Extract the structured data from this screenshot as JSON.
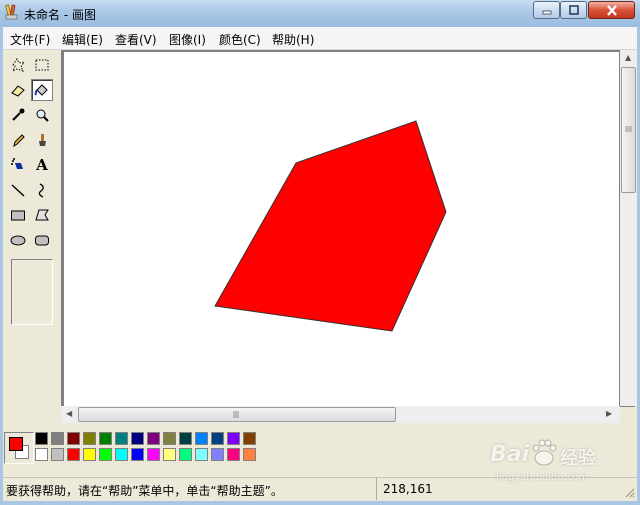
{
  "window": {
    "title": "未命名 - 画图"
  },
  "menu": [
    "文件(F)",
    "编辑(E)",
    "查看(V)",
    "图像(I)",
    "颜色(C)",
    "帮助(H)"
  ],
  "tools": [
    {
      "name": "free-form-select-icon"
    },
    {
      "name": "rect-select-icon"
    },
    {
      "name": "eraser-icon"
    },
    {
      "name": "fill-bucket-icon"
    },
    {
      "name": "eyedropper-icon"
    },
    {
      "name": "magnifier-icon"
    },
    {
      "name": "pencil-icon"
    },
    {
      "name": "brush-icon"
    },
    {
      "name": "airbrush-icon"
    },
    {
      "name": "text-tool-icon",
      "glyph": "A"
    },
    {
      "name": "line-icon"
    },
    {
      "name": "curve-icon"
    },
    {
      "name": "rectangle-icon"
    },
    {
      "name": "polygon-icon"
    },
    {
      "name": "ellipse-icon"
    },
    {
      "name": "rounded-rect-icon"
    }
  ],
  "selected_tool": "fill-bucket-icon",
  "canvas": {
    "shape_fill": "#ff0000",
    "shape_stroke": "#333333"
  },
  "colors": {
    "foreground": "#ff0000",
    "background": "#ffffff",
    "palette_top": [
      "#000000",
      "#808080",
      "#800000",
      "#808000",
      "#008000",
      "#008080",
      "#000080",
      "#800080",
      "#808040",
      "#004040",
      "#0080ff",
      "#004080",
      "#8000ff",
      "#804000"
    ],
    "palette_bottom": [
      "#ffffff",
      "#c0c0c0",
      "#ff0000",
      "#ffff00",
      "#00ff00",
      "#00ffff",
      "#0000ff",
      "#ff00ff",
      "#ffff80",
      "#00ff80",
      "#80ffff",
      "#8080ff",
      "#ff0080",
      "#ff8040"
    ]
  },
  "status": {
    "help_text": "要获得帮助，请在“帮助”菜单中，单击“帮助主题”。",
    "coords": "218,161"
  },
  "watermark": {
    "brand": "Bai",
    "brand_tail": "经验",
    "url": "jingyan.baidu.com"
  }
}
